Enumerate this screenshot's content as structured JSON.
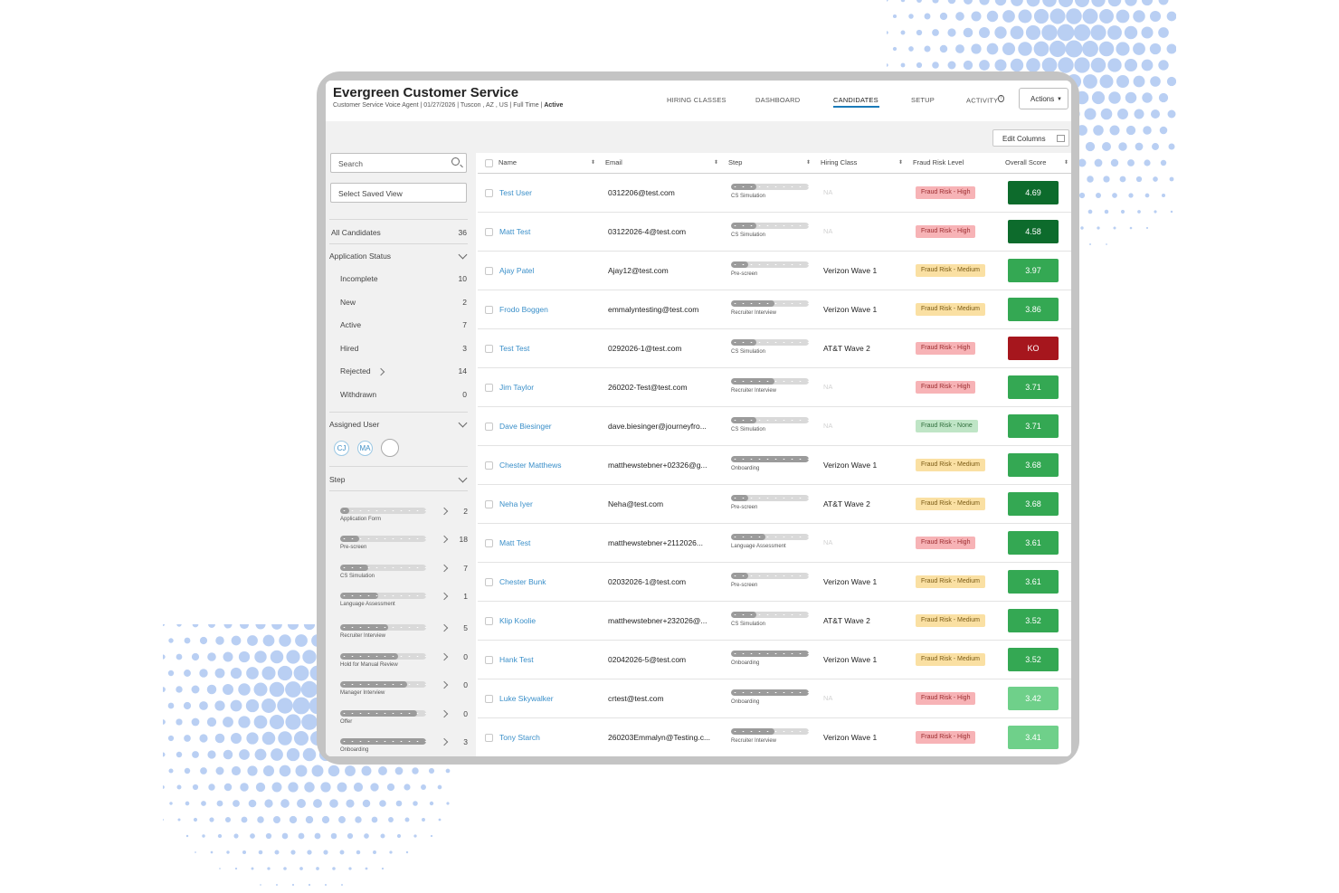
{
  "app": {
    "title": "Evergreen Customer Service",
    "subtitle": "Customer Service Voice Agent | 01/27/2026 | Tuscon , AZ , US | Full Time |",
    "status": "Active"
  },
  "nav": {
    "tabs": [
      {
        "label": "HIRING CLASSES",
        "active": false
      },
      {
        "label": "DASHBOARD",
        "active": false
      },
      {
        "label": "CANDIDATES",
        "active": true
      },
      {
        "label": "SETUP",
        "active": false
      },
      {
        "label": "ACTIVITY",
        "active": false
      }
    ],
    "activity_badge": "!",
    "actions_label": "Actions"
  },
  "toolbar": {
    "edit_columns_label": "Edit Columns"
  },
  "sidebar": {
    "search_placeholder": "Search",
    "saved_view_label": "Select Saved View",
    "all_candidates": {
      "label": "All Candidates",
      "count": "36"
    },
    "application_status": {
      "title": "Application Status",
      "items": [
        {
          "label": "Incomplete",
          "count": "10"
        },
        {
          "label": "New",
          "count": "2"
        },
        {
          "label": "Active",
          "count": "7"
        },
        {
          "label": "Hired",
          "count": "3"
        },
        {
          "label": "Rejected",
          "count": "14"
        },
        {
          "label": "Withdrawn",
          "count": "0"
        }
      ]
    },
    "assigned_user": {
      "title": "Assigned User",
      "avatars": [
        "CJ",
        "MA",
        ""
      ]
    },
    "step": {
      "title": "Step",
      "items": [
        {
          "label": "Application Form",
          "count": "2",
          "progress": 0.11
        },
        {
          "label": "Pre-screen",
          "count": "18",
          "progress": 0.22
        },
        {
          "label": "CS Simulation",
          "count": "7",
          "progress": 0.33
        },
        {
          "label": "Language Assessment",
          "count": "1",
          "progress": 0.44
        },
        {
          "label": "Recruiter Interview",
          "count": "5",
          "progress": 0.56
        },
        {
          "label": "Hold for Manual Review",
          "count": "0",
          "progress": 0.67
        },
        {
          "label": "Manager Interview",
          "count": "0",
          "progress": 0.78
        },
        {
          "label": "Offer",
          "count": "0",
          "progress": 0.89
        },
        {
          "label": "Onboarding",
          "count": "3",
          "progress": 1.0
        }
      ]
    }
  },
  "table": {
    "columns": [
      "Name",
      "Email",
      "Step",
      "Hiring Class",
      "Fraud Risk Level",
      "Overall Score"
    ],
    "rows": [
      {
        "name": "Test User",
        "email": "0312206@test.com",
        "step": "CS Simulation",
        "step_progress": 0.33,
        "hiring_class": "NA",
        "fraud": "Fraud Risk - High",
        "fraud_level": "high",
        "score": "4.69",
        "score_color": "#0d6b2c"
      },
      {
        "name": "Matt Test",
        "email": "03122026-4@test.com",
        "step": "CS Simulation",
        "step_progress": 0.33,
        "hiring_class": "NA",
        "fraud": "Fraud Risk - High",
        "fraud_level": "high",
        "score": "4.58",
        "score_color": "#0d6b2c"
      },
      {
        "name": "Ajay Patel",
        "email": "Ajay12@test.com",
        "step": "Pre-screen",
        "step_progress": 0.22,
        "hiring_class": "Verizon Wave 1",
        "fraud": "Fraud Risk - Medium",
        "fraud_level": "medium",
        "score": "3.97",
        "score_color": "#34a853"
      },
      {
        "name": "Frodo Boggen",
        "email": "emmalyntesting@test.com",
        "step": "Recruiter Interview",
        "step_progress": 0.56,
        "hiring_class": "Verizon Wave 1",
        "fraud": "Fraud Risk - Medium",
        "fraud_level": "medium",
        "score": "3.86",
        "score_color": "#34a853"
      },
      {
        "name": "Test Test",
        "email": "0292026-1@test.com",
        "step": "CS Simulation",
        "step_progress": 0.33,
        "hiring_class": "AT&T Wave 2",
        "fraud": "Fraud Risk - High",
        "fraud_level": "high",
        "score": "KO",
        "score_color": "#a6161d"
      },
      {
        "name": "Jim Taylor",
        "email": "260202-Test@test.com",
        "step": "Recruiter Interview",
        "step_progress": 0.56,
        "hiring_class": "NA",
        "fraud": "Fraud Risk - High",
        "fraud_level": "high",
        "score": "3.71",
        "score_color": "#34a853"
      },
      {
        "name": "Dave Biesinger",
        "email": "dave.biesinger@journeyfro...",
        "step": "CS Simulation",
        "step_progress": 0.33,
        "hiring_class": "NA",
        "fraud": "Fraud Risk - None",
        "fraud_level": "none",
        "score": "3.71",
        "score_color": "#34a853"
      },
      {
        "name": "Chester Matthews",
        "email": "matthewstebner+02326@g...",
        "step": "Onboarding",
        "step_progress": 1.0,
        "hiring_class": "Verizon Wave 1",
        "fraud": "Fraud Risk - Medium",
        "fraud_level": "medium",
        "score": "3.68",
        "score_color": "#34a853"
      },
      {
        "name": "Neha Iyer",
        "email": "Neha@test.com",
        "step": "Pre-screen",
        "step_progress": 0.22,
        "hiring_class": "AT&T Wave 2",
        "fraud": "Fraud Risk - Medium",
        "fraud_level": "medium",
        "score": "3.68",
        "score_color": "#34a853"
      },
      {
        "name": "Matt Test",
        "email": "matthewstebner+2112026...",
        "step": "Language Assessment",
        "step_progress": 0.44,
        "hiring_class": "NA",
        "fraud": "Fraud Risk - High",
        "fraud_level": "high",
        "score": "3.61",
        "score_color": "#34a853"
      },
      {
        "name": "Chester Bunk",
        "email": "02032026-1@test.com",
        "step": "Pre-screen",
        "step_progress": 0.22,
        "hiring_class": "Verizon Wave 1",
        "fraud": "Fraud Risk - Medium",
        "fraud_level": "medium",
        "score": "3.61",
        "score_color": "#34a853"
      },
      {
        "name": "Klip Koolie",
        "email": "matthewstebner+232026@...",
        "step": "CS Simulation",
        "step_progress": 0.33,
        "hiring_class": "AT&T Wave 2",
        "fraud": "Fraud Risk - Medium",
        "fraud_level": "medium",
        "score": "3.52",
        "score_color": "#34a853"
      },
      {
        "name": "Hank Test",
        "email": "02042026-5@test.com",
        "step": "Onboarding",
        "step_progress": 1.0,
        "hiring_class": "Verizon Wave 1",
        "fraud": "Fraud Risk - Medium",
        "fraud_level": "medium",
        "score": "3.52",
        "score_color": "#34a853"
      },
      {
        "name": "Luke Skywalker",
        "email": "crtest@test.com",
        "step": "Onboarding",
        "step_progress": 1.0,
        "hiring_class": "NA",
        "fraud": "Fraud Risk - High",
        "fraud_level": "high",
        "score": "3.42",
        "score_color": "#6fd08a"
      },
      {
        "name": "Tony Starch",
        "email": "260203Emmalyn@Testing.c...",
        "step": "Recruiter Interview",
        "step_progress": 0.56,
        "hiring_class": "Verizon Wave 1",
        "fraud": "Fraud Risk - High",
        "fraud_level": "high",
        "score": "3.41",
        "score_color": "#6fd08a"
      }
    ]
  }
}
